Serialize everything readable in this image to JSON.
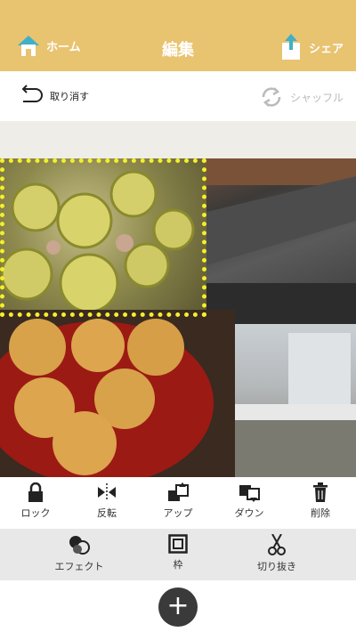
{
  "header": {
    "home_label": "ホーム",
    "title": "編集",
    "share_label": "シェア",
    "bg_color": "#e8c370"
  },
  "toolbar1": {
    "undo_label": "取り消す",
    "shuffle_label": "シャッフル"
  },
  "edit_tools": [
    {
      "label": "ロック",
      "icon": "lock-icon"
    },
    {
      "label": "反転",
      "icon": "flip-icon"
    },
    {
      "label": "アップ",
      "icon": "bring-forward-icon"
    },
    {
      "label": "ダウン",
      "icon": "send-backward-icon"
    },
    {
      "label": "削除",
      "icon": "trash-icon"
    }
  ],
  "style_tools": [
    {
      "label": "エフェクト",
      "icon": "effect-icon"
    },
    {
      "label": "枠",
      "icon": "frame-icon"
    },
    {
      "label": "切り抜き",
      "icon": "scissors-icon"
    }
  ],
  "bottom": {
    "add_icon": "plus-icon"
  },
  "selection_color": "#f5ef2a"
}
